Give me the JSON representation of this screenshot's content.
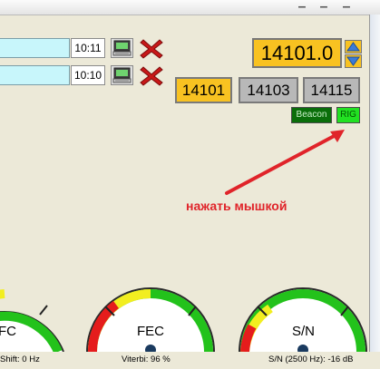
{
  "rows": [
    {
      "time": "10:11"
    },
    {
      "time": "10:10"
    }
  ],
  "frequency": {
    "display": "14101.0"
  },
  "presets": [
    {
      "label": "14101",
      "state": "active"
    },
    {
      "label": "14103",
      "state": "idle"
    },
    {
      "label": "14115",
      "state": "idle"
    }
  ],
  "buttons": {
    "beacon": "Beacon",
    "rig": "RIG"
  },
  "annotation": "нажать мышкой",
  "gauges": [
    {
      "name": "fc",
      "label": "FC",
      "status": "Shift: 0 Hz"
    },
    {
      "name": "fec",
      "label": "FEC",
      "status": "Viterbi: 96 %"
    },
    {
      "name": "sn",
      "label": "S/N",
      "status": "S/N (2500 Hz): -16 dB"
    }
  ],
  "colors": {
    "accent": "#f8c221",
    "input": "#c8f6fb",
    "gauge_green": "#23c21b",
    "gauge_yellow": "#f2ee20",
    "gauge_red": "#e51c1c",
    "annotation": "#e0242a",
    "beacon": "#0a6e0a",
    "rig": "#22e122"
  },
  "icons": [
    "computer-icon",
    "close-x-icon",
    "spin-up-icon",
    "spin-down-icon",
    "window-close-icon",
    "maximize-icon"
  ]
}
